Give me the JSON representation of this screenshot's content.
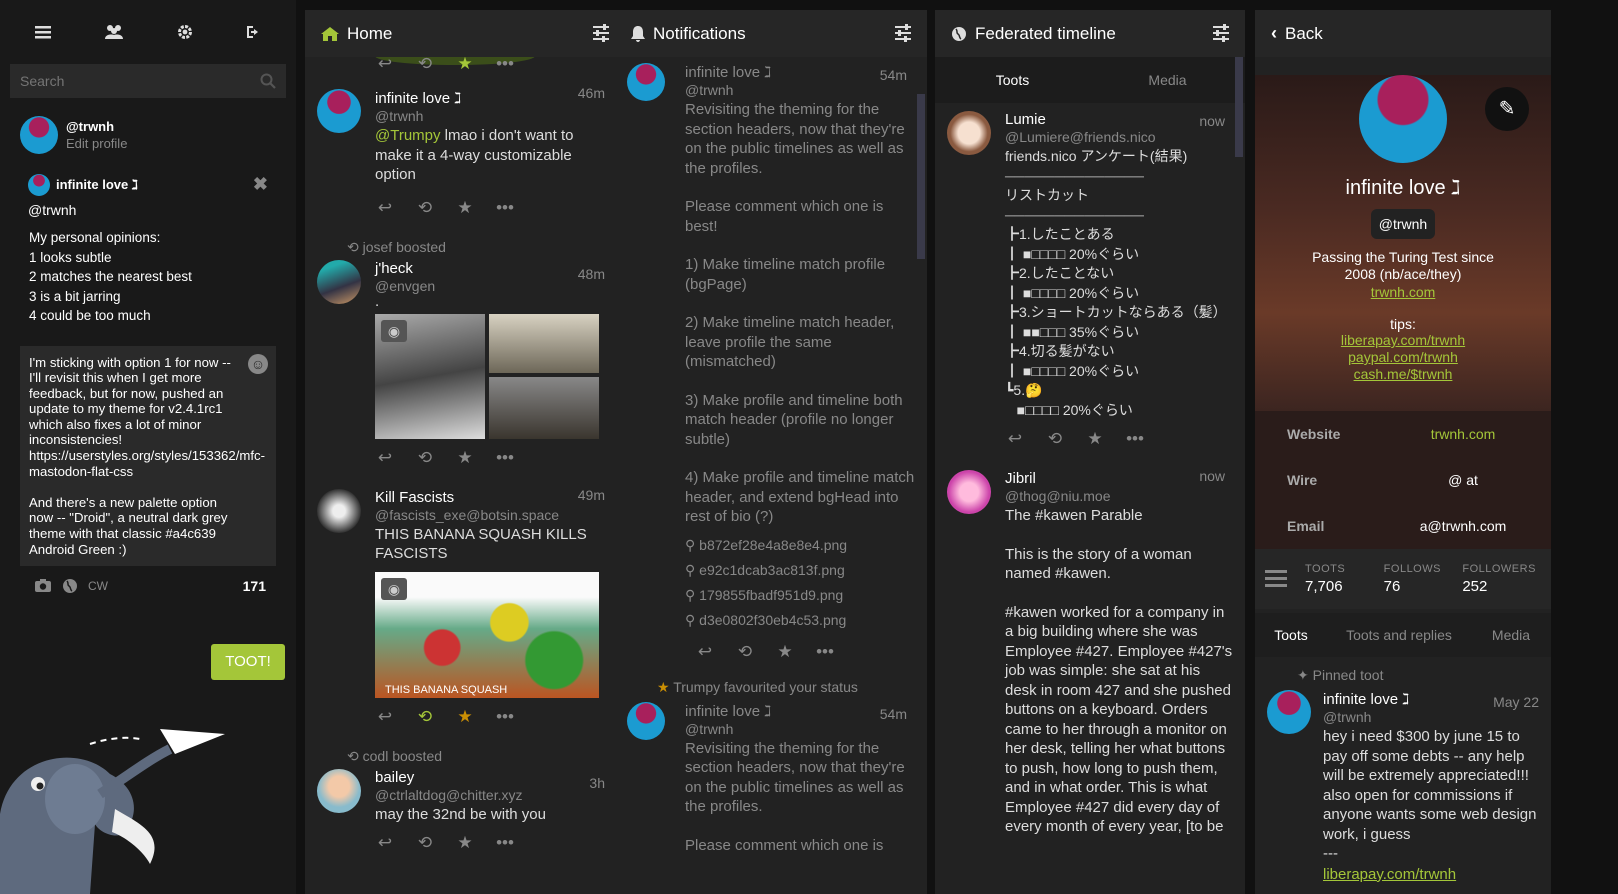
{
  "nav": {
    "menu_icon": "hamburger-icon",
    "people_icon": "people-icon",
    "settings_icon": "gear-icon",
    "logout_icon": "logout-icon"
  },
  "search": {
    "placeholder": "Search"
  },
  "self": {
    "handle": "@trwnh",
    "edit": "Edit profile"
  },
  "compose": {
    "reply_name": "infinite love ℷ",
    "reply_acct": "@trwnh",
    "reply_text": "My personal opinions:\n1 looks subtle\n2 matches the nearest best\n3 is a bit jarring\n4 could be too much",
    "draft": "I'm sticking with option 1 for now -- I'll revisit this when I get more feedback, but for now, pushed an update to my theme for v2.4.1rc1 which also fixes a lot of minor inconsistencies! https://userstyles.org/styles/153362/mfc-mastodon-flat-css\n\nAnd there's a new palette option now -- \"Droid\", a neutral dark grey theme with that classic #a4c639 Android Green :)",
    "cw": "CW",
    "count": "171",
    "submit": "TOOT!"
  },
  "home": {
    "title": "Home",
    "toots": [
      {
        "name": "infinite love ℷ",
        "acct": "@trwnh",
        "time": "46m",
        "mention": "@Trumpy",
        "text": " lmao i don't want to make it a 4-way customizable option"
      },
      {
        "boost": "josef boosted",
        "name": "j'heck",
        "acct": "@envgen",
        "time": "48m",
        "text": "."
      },
      {
        "name": "Kill Fascists",
        "acct": "@fascists_exe@botsin.space",
        "time": "49m",
        "text": "THIS BANANA SQUASH KILLS FASCISTS",
        "caption": "THIS BANANA SQUASH"
      },
      {
        "boost": "codl boosted",
        "name": "bailey",
        "acct": "@ctrlaltdog@chitter.xyz",
        "time": "3h",
        "text": "may the 32nd be with you"
      }
    ]
  },
  "notifications": {
    "title": "Notifications",
    "n1": {
      "name": "infinite love ℷ",
      "acct": "@trwnh",
      "time": "54m",
      "paras": [
        "Revisiting the theming for the section headers, now that they're on the public timelines as well as the profiles.",
        "Please comment which one is best!",
        "1) Make timeline match profile (bgPage)",
        "2) Make timeline match header, leave profile the same (mismatched)",
        "3) Make profile and timeline both match header (profile no longer subtle)",
        "4) Make profile and timeline match header, and extend bgHead into rest of bio (?)"
      ],
      "links": [
        "b872ef28e4a8e8e4.png",
        "e92c1dcab3ac813f.png",
        "179855fbadf951d9.png",
        "d3e0802f30eb4c53.png"
      ]
    },
    "fav": "Trumpy favourited your status",
    "n2": {
      "name": "infinite love ℷ",
      "acct": "@trwnh",
      "time": "54m",
      "paras": [
        "Revisiting the theming for the section headers, now that they're on the public timelines as well as the profiles.",
        "Please comment which one is"
      ]
    }
  },
  "federated": {
    "title": "Federated timeline",
    "tabs": [
      "Toots",
      "Media"
    ],
    "t1": {
      "name": "Lumie",
      "acct": "@Lumiere@friends.nico",
      "time": "now",
      "lines": [
        "friends.nico アンケート(結果)",
        "──────────────",
        "リストカット",
        "──────────────",
        "┣1.したことある",
        "┃ ■□□□□ 20%ぐらい",
        "┣2.したことない",
        "┃ ■□□□□ 20%ぐらい",
        "┣3.ショートカットならある（髪）",
        "┃ ■■□□□ 35%ぐらい",
        "┣4.切る髪がない",
        "┃ ■□□□□ 20%ぐらい",
        "┗5.🤔",
        "   ■□□□□ 20%ぐらい"
      ]
    },
    "t2": {
      "name": "Jibril",
      "acct": "@thog@niu.moe",
      "time": "now",
      "text": [
        "The #kawen Parable",
        "This is the story of a woman named #kawen.",
        "#kawen worked for a company in a big building where she was Employee #427. Employee #427's job was simple: she sat at his desk in room 427 and she pushed buttons on a keyboard. Orders came to her through a monitor on her desk, telling her what buttons to push, how long to push them, and in what order. This is what Employee #427 did every day of every month of every year, [to be"
      ]
    }
  },
  "profile": {
    "back": "Back",
    "name": "infinite love ℷ",
    "acct": "@trwnh",
    "bio": "Passing the Turing Test since 2008 (nb/ace/they)",
    "site": "trwnh.com",
    "tips": "tips:",
    "tip_links": [
      "liberapay.com/trwnh",
      "paypal.com/trwnh",
      "cash.me/$trwnh"
    ],
    "fields": [
      {
        "k": "Website",
        "v": "trwnh.com"
      },
      {
        "k": "Wire",
        "v": "@ at"
      },
      {
        "k": "Email",
        "v": "a@trwnh.com"
      }
    ],
    "stats": [
      {
        "k": "TOOTS",
        "v": "7,706"
      },
      {
        "k": "FOLLOWS",
        "v": "76"
      },
      {
        "k": "FOLLOWERS",
        "v": "252"
      }
    ],
    "tabs": [
      "Toots",
      "Toots and replies",
      "Media"
    ],
    "pinned": "Pinned toot",
    "toot": {
      "name": "infinite love ℷ",
      "acct": "@trwnh",
      "time": "May 22",
      "text": "hey i need $300 by june 15 to pay off some debts -- any help will be extremely appreciated!!! also open for commissions if anyone wants some web design work, i guess\n---",
      "link": "liberapay.com/trwnh"
    }
  },
  "colors": {
    "accent": "#a4c639",
    "star": "#ca8f04"
  }
}
